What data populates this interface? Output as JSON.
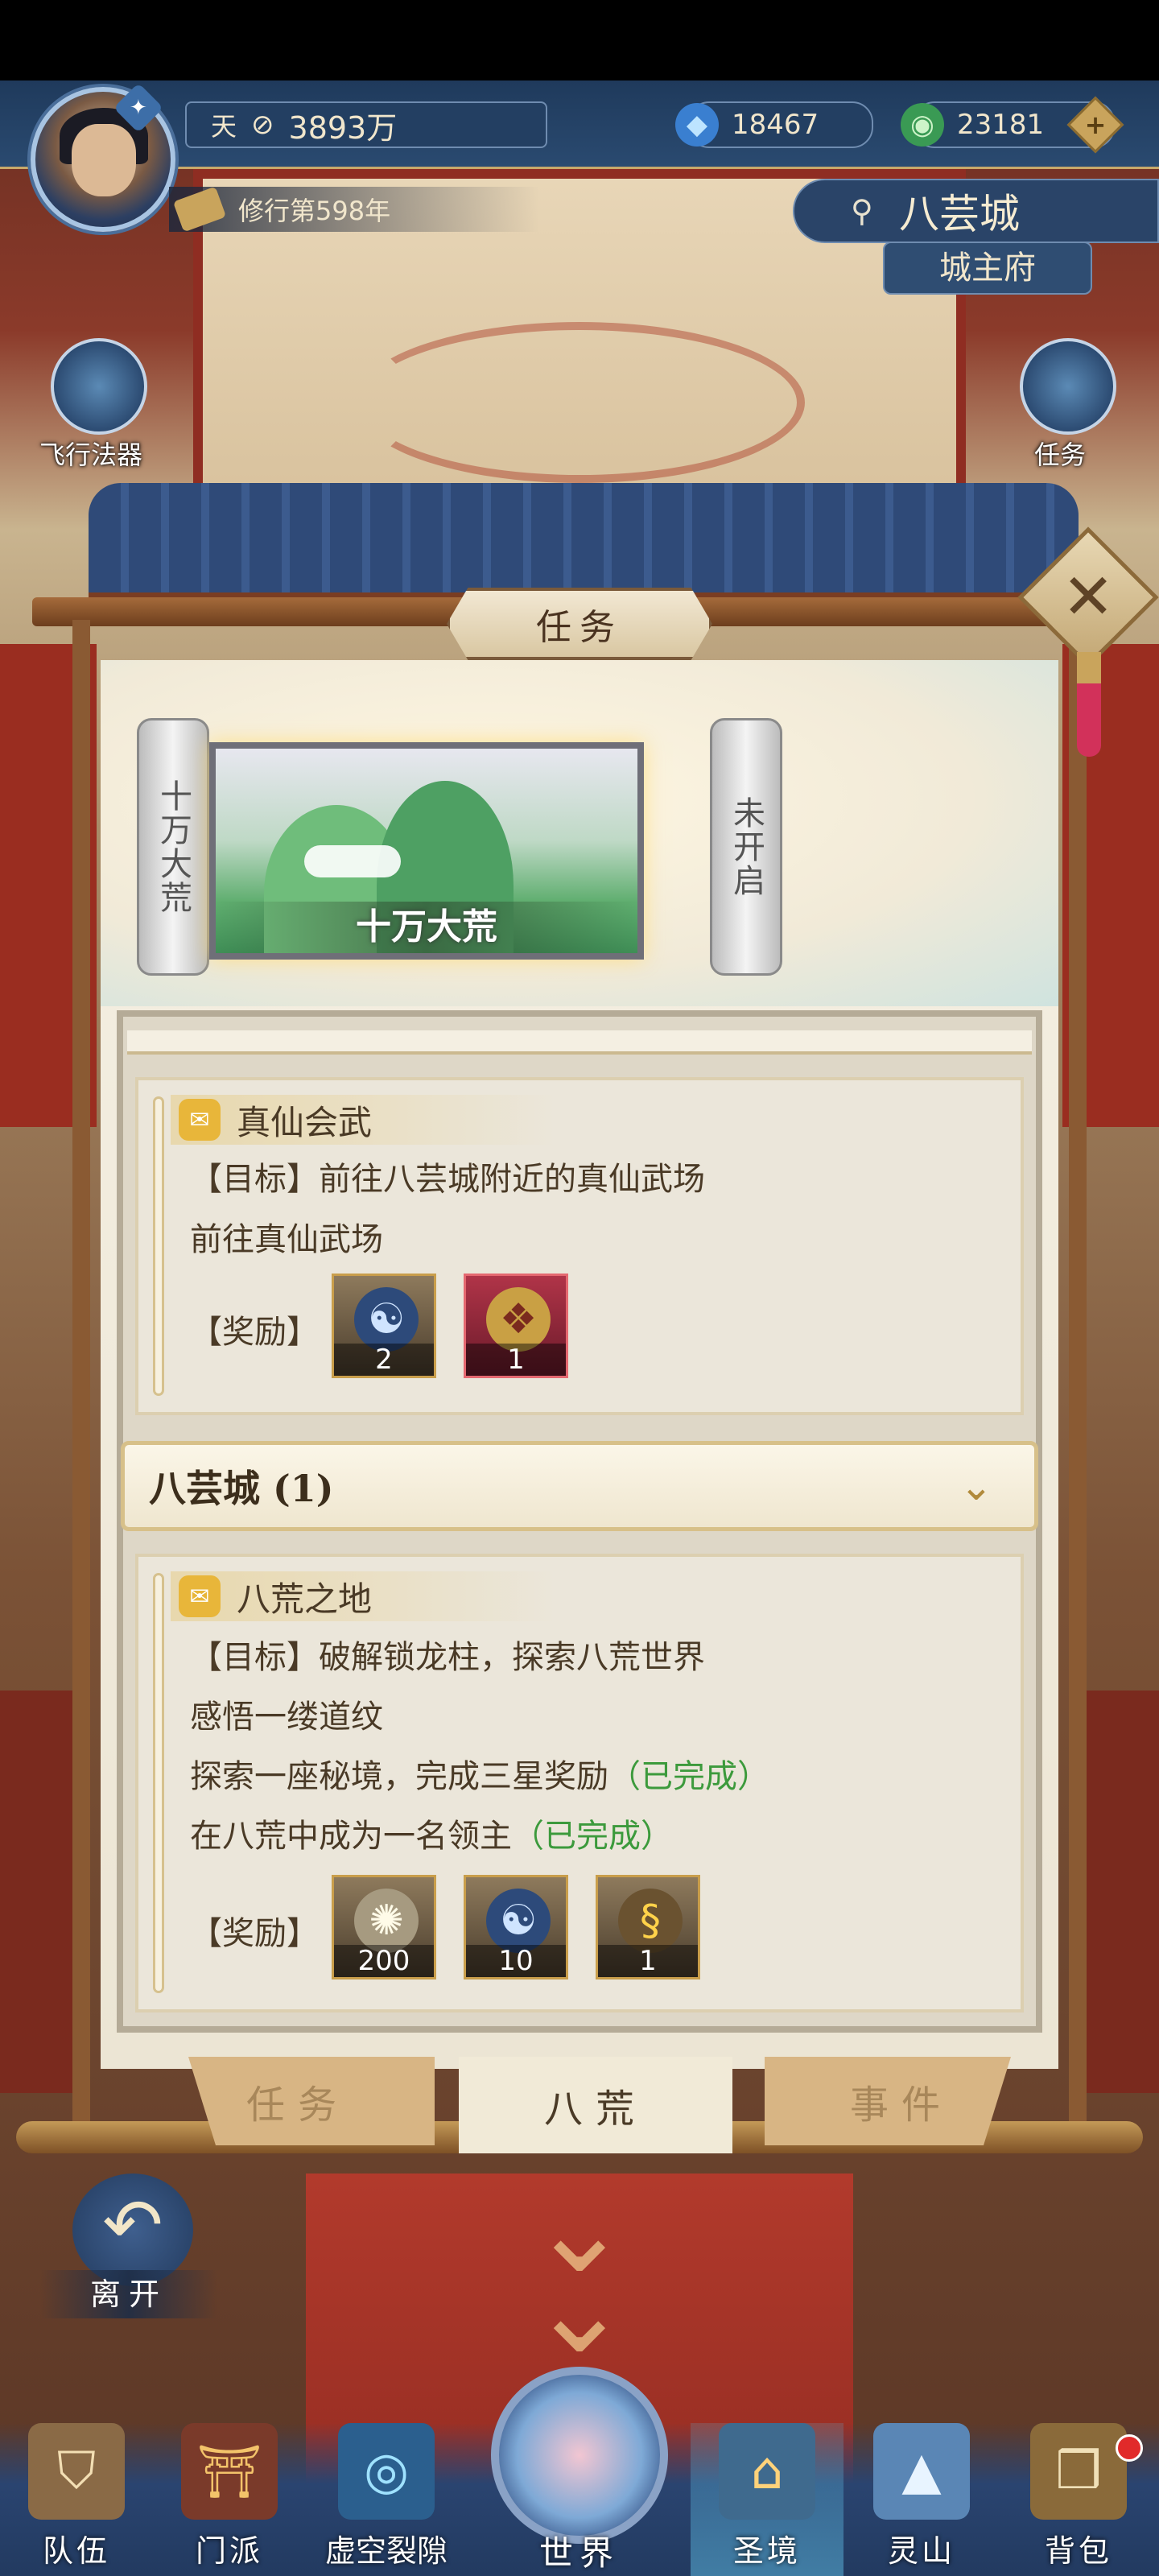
{
  "hud": {
    "realm_tag": "天",
    "power": "3893万",
    "gems": "18467",
    "jade": "23181",
    "cultivation": "修行第598年"
  },
  "location": {
    "city": "八芸城",
    "place": "城主府"
  },
  "side_buttons": {
    "flying_artifact": "飞行法器",
    "tasks": "任务"
  },
  "panel": {
    "title": "任务",
    "close_icon": "close-icon"
  },
  "realms": {
    "unlocked_scroll": "十万大荒",
    "selected_card": "十万大荒",
    "locked_scroll": "未开启"
  },
  "quests": [
    {
      "name": "真仙会武",
      "lines": [
        "【目标】前往八芸城附近的真仙武场",
        "前往真仙武场"
      ],
      "reward_label": "【奖励】",
      "rewards": [
        {
          "icon": "yin-yang-orb-icon",
          "count": "2"
        },
        {
          "icon": "red-treasure-bag-icon",
          "count": "1"
        }
      ]
    },
    {
      "name": "八荒之地",
      "lines": [
        {
          "text": "【目标】破解锁龙柱，探索八荒世界",
          "status": ""
        },
        {
          "text": "感悟一缕道纹",
          "status": ""
        },
        {
          "text": "探索一座秘境，完成三星奖励",
          "status": "（已完成）"
        },
        {
          "text": "在八荒中成为一名领主",
          "status": "（已完成）"
        }
      ],
      "reward_label": "【奖励】",
      "rewards": [
        {
          "icon": "spirit-essence-icon",
          "count": "200"
        },
        {
          "icon": "yin-yang-orb-icon",
          "count": "10"
        },
        {
          "icon": "golden-dragon-icon",
          "count": "1"
        }
      ]
    }
  ],
  "city_group": {
    "label": "八芸城 (1)"
  },
  "tabs": {
    "task": "任务",
    "bahuang": "八荒",
    "event": "事件",
    "active": "八荒"
  },
  "leave": "离开",
  "nav": {
    "team": "队伍",
    "sect": "门派",
    "void_rift": "虚空裂隙",
    "world": "世界",
    "holy_realm": "圣境",
    "spirit_mountain": "灵山",
    "backpack": "背包"
  },
  "colors": {
    "done_green": "#3c9a3c",
    "hud_blue": "#233f62",
    "panel_cream": "#ebe6da",
    "frame_brown": "#8a5a33"
  }
}
